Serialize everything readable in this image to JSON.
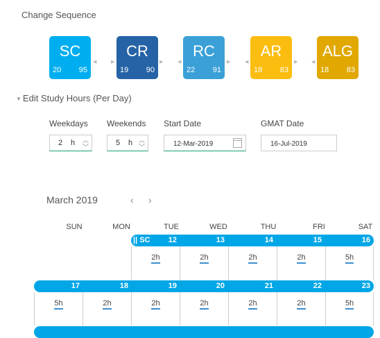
{
  "sequence": {
    "title": "Change Sequence",
    "tiles": [
      {
        "code": "SC",
        "a": "20",
        "b": "95",
        "color": "#00aeef"
      },
      {
        "code": "CR",
        "a": "19",
        "b": "90",
        "color": "#2563a6"
      },
      {
        "code": "RC",
        "a": "22",
        "b": "91",
        "color": "#3ba0d8"
      },
      {
        "code": "AR",
        "a": "18",
        "b": "83",
        "color": "#fbbd0f"
      },
      {
        "code": "ALG",
        "a": "18",
        "b": "83",
        "color": "#e0a800"
      }
    ]
  },
  "study": {
    "title": "Edit Study Hours (Per Day)",
    "weekdays_label": "Weekdays",
    "weekdays_value": "2",
    "weekends_label": "Weekends",
    "weekends_value": "5",
    "unit": "h",
    "start_label": "Start Date",
    "start_value": "12-Mar-2019",
    "gmat_label": "GMAT Date",
    "gmat_value": "16-Jul-2019"
  },
  "calendar": {
    "month": "March 2019",
    "prev": "‹",
    "next": "›",
    "days": [
      "SUN",
      "MON",
      "TUE",
      "WED",
      "THU",
      "FRI",
      "SAT"
    ],
    "week1": {
      "marker": "|| SC",
      "nums": [
        "12",
        "13",
        "14",
        "15",
        "16"
      ],
      "hours": [
        "2h",
        "2h",
        "2h",
        "2h",
        "5h"
      ]
    },
    "week2": {
      "nums": [
        "17",
        "18",
        "19",
        "20",
        "21",
        "22",
        "23"
      ],
      "hours": [
        "5h",
        "2h",
        "2h",
        "2h",
        "2h",
        "2h",
        "5h"
      ]
    }
  }
}
